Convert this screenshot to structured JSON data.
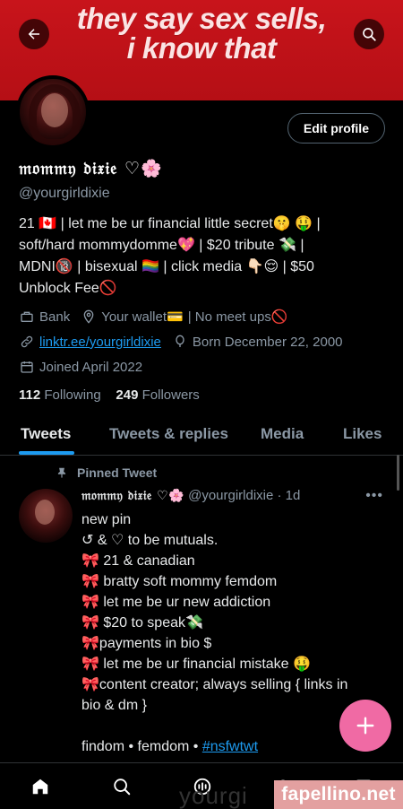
{
  "banner": {
    "line1": "they say sex sells,",
    "line2": "i know that"
  },
  "profile": {
    "edit_label": "Edit profile",
    "display_name": "𝔪𝔬𝔪𝔪𝔶 𝔡𝔦𝔵𝔦𝔢 ♡🌸",
    "handle": "@yourgirldixie",
    "bio_lines": [
      "21 🇨🇦 | let me be ur financial little secret🤫 🤑 |",
      "soft/hard mommydomme💖 | $20 tribute 💸 |",
      "MDNI🔞 | bisexual 🏳️‍🌈 | click media 👇🏻😌 | $50",
      "Unblock Fee🚫"
    ],
    "meta": {
      "location": "Bank",
      "place": "Your wallet💳",
      "place_extra": "| No meet ups🚫",
      "link": "linktr.ee/yourgirldixie",
      "born": "Born December 22, 2000",
      "joined": "Joined April 2022"
    },
    "following_count": "112",
    "following_label": "Following",
    "followers_count": "249",
    "followers_label": "Followers"
  },
  "tabs": [
    {
      "label": "Tweets",
      "active": true
    },
    {
      "label": "Tweets & replies",
      "active": false
    },
    {
      "label": "Media",
      "active": false
    },
    {
      "label": "Likes",
      "active": false
    }
  ],
  "tweet": {
    "pinned_label": "Pinned Tweet",
    "author_name": "𝔪𝔬𝔪𝔪𝔶 𝔡𝔦𝔵𝔦𝔢 ♡🌸",
    "author_handle": "@yourgirldixie · 1d",
    "more": "•••",
    "lines": [
      "new pin",
      "↺ & ♡ to be mutuals.",
      "🎀 21 & canadian",
      "🎀 bratty soft mommy femdom",
      "🎀 let me be ur new addiction",
      "🎀 $20 to speak💸",
      "🎀payments in bio $",
      "🎀 let me be ur financial mistake 🤑",
      "🎀content creator; always selling { links in",
      "bio & dm }"
    ],
    "footer_prefix": "findom • femdom • ",
    "hashtag": "#nsfwtwt"
  },
  "watermark": {
    "ghost": "yourgi",
    "label": "fapellino.net"
  },
  "colors": {
    "banner_red": "#c8141b",
    "link_blue": "#1d9bf0",
    "fab_pink": "#f06aa4",
    "muted": "#8b98a5"
  },
  "icons": [
    "back-arrow-icon",
    "search-icon",
    "bank-icon",
    "location-icon",
    "link-icon",
    "balloon-icon",
    "calendar-icon",
    "pin-icon",
    "plus-icon",
    "home-icon",
    "spaces-icon",
    "notifications-icon",
    "messages-icon"
  ]
}
